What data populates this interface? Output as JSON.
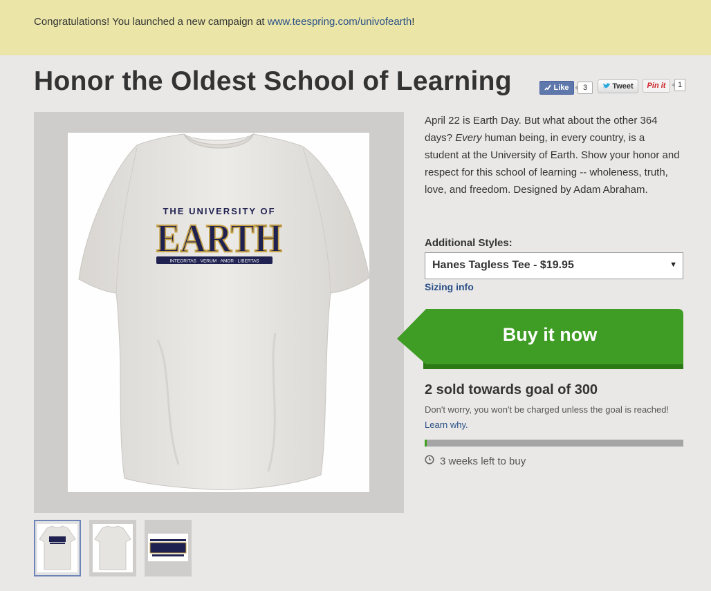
{
  "banner": {
    "text_before": "Congratulations! You launched a new campaign at ",
    "link": "www.teespring.com/univofearth",
    "text_after": "!"
  },
  "title": "Honor the Oldest School of Learning",
  "social": {
    "like_label": "Like",
    "like_count": "3",
    "tweet_label": "Tweet",
    "pin_label": "Pin it",
    "pin_count": "1"
  },
  "product": {
    "shirt_logo_top": "THE UNIVERSITY OF",
    "shirt_logo_main": "EARTH",
    "shirt_logo_motto": "INTEGRITAS · VERUM · AMOR · LIBERTAS"
  },
  "description": {
    "part1": "April 22 is Earth Day. But what about the other 364 days? ",
    "emphasis": "Every",
    "part2": " human being, in every country, is a student at the University of Earth. Show your honor and respect for this school of learning -- wholeness, truth, love, and freedom. Designed by Adam Abraham."
  },
  "styles": {
    "label": "Additional Styles:",
    "selected": "Hanes Tagless Tee - $19.95",
    "sizing_link": "Sizing info"
  },
  "buy": {
    "label": "Buy it now"
  },
  "goal": {
    "sold_text": "2 sold towards goal of 300",
    "sold": 2,
    "target": 300,
    "note": "Don't worry, you won't be charged unless the goal is reached! ",
    "note_link": "Learn why.",
    "time_left": "3 weeks left to buy"
  },
  "colors": {
    "banner": "#ebe6a8",
    "accent_green": "#3f9c24",
    "link_blue": "#2a4f86",
    "shirt_navy": "#1f2150",
    "shirt_gold": "#c8a44a"
  },
  "thumbnails": [
    {
      "name": "front view",
      "selected": true
    },
    {
      "name": "back view",
      "selected": false
    },
    {
      "name": "design view",
      "selected": false
    }
  ]
}
